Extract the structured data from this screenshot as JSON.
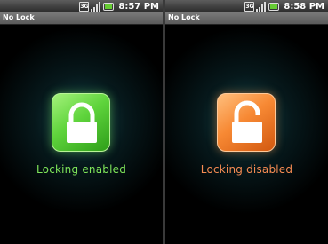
{
  "screens": [
    {
      "status_bar": {
        "network_label": "3G",
        "time": "8:57 PM"
      },
      "title": "No Lock",
      "lock_state": "locked",
      "status_text": "Locking enabled",
      "accent_color": "#6fe04a",
      "icons": [
        "3g-icon",
        "signal-icon",
        "battery-icon",
        "padlock-closed-icon"
      ]
    },
    {
      "status_bar": {
        "network_label": "3G",
        "time": "8:58 PM"
      },
      "title": "No Lock",
      "lock_state": "unlocked",
      "status_text": "Locking disabled",
      "accent_color": "#f07d3e",
      "icons": [
        "3g-icon",
        "signal-icon",
        "battery-icon",
        "padlock-open-icon"
      ]
    }
  ]
}
